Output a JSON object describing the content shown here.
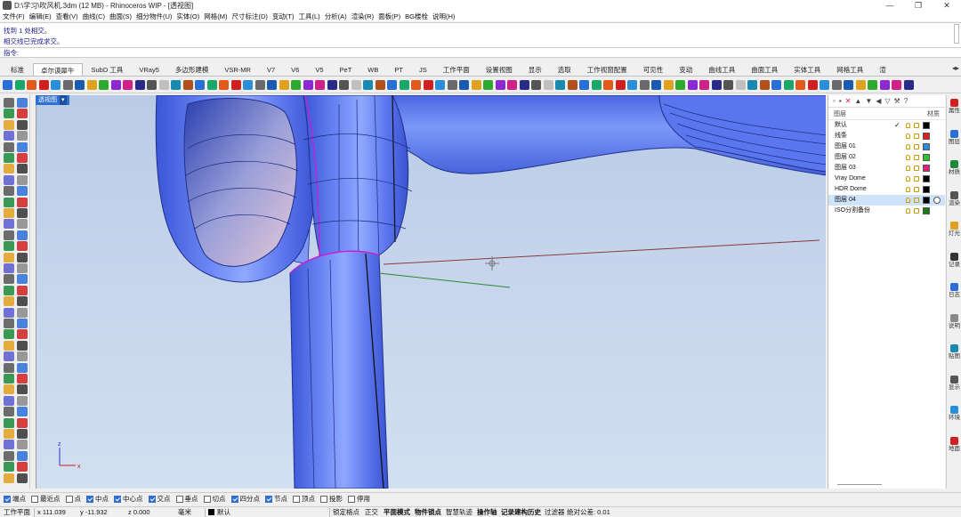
{
  "window": {
    "title": "D:\\学习\\吹风机.3dm (12 MB) - Rhinoceros WIP - [透视图]",
    "controls": [
      "—",
      "❐",
      "✕"
    ]
  },
  "menu": [
    "文件(F)",
    "编辑(E)",
    "查看(V)",
    "曲线(C)",
    "曲面(S)",
    "细分物件(U)",
    "实体(O)",
    "网格(M)",
    "尺寸标注(D)",
    "变动(T)",
    "工具(L)",
    "分析(A)",
    "渲染(R)",
    "面板(P)",
    "BG楼栓",
    "说明(H)"
  ],
  "command_history": [
    "找到 1 处相交。",
    "相交线已完成求交。"
  ],
  "command_prompt": "指令:",
  "toolbar_tabs": [
    "标准",
    "卓尔谟犀牛",
    "SubD 工具",
    "VRay5",
    "多边形建模",
    "VSR-MR",
    "V7",
    "V6",
    "V5",
    "PeT",
    "WB",
    "PT",
    "JS",
    "工作平面",
    "设置视图",
    "显示",
    "选取",
    "工作视窗配置",
    "可见性",
    "变动",
    "曲线工具",
    "曲面工具",
    "实体工具",
    "网格工具",
    "渲"
  ],
  "active_tab_index": 1,
  "viewport": {
    "label": "透视图",
    "axis": {
      "z": "z",
      "x": "x"
    }
  },
  "layers_panel": {
    "header_left": "图层",
    "header_right": "材质",
    "layers": [
      {
        "name": "默认",
        "current": "✓",
        "color": "#000000"
      },
      {
        "name": "线条",
        "current": "",
        "color": "#e02020"
      },
      {
        "name": "图层 01",
        "current": "",
        "color": "#2a8fd8"
      },
      {
        "name": "图层 02",
        "current": "",
        "color": "#2ec22e"
      },
      {
        "name": "图层 03",
        "current": "",
        "color": "#e0207a"
      },
      {
        "name": "Vray Dome",
        "current": "",
        "color": "#000000"
      },
      {
        "name": "HDR Dome",
        "current": "",
        "color": "#000000"
      },
      {
        "name": "图层 04",
        "current": "",
        "color": "#000000",
        "selected": true
      },
      {
        "name": "ISO分割备份",
        "current": "",
        "color": "#1a7a1a"
      }
    ]
  },
  "side_tabs": [
    "属性",
    "图层",
    "材质",
    "渲染",
    "灯光",
    "记录",
    "日志",
    "说明",
    "贴图",
    "显示",
    "环境",
    "地面"
  ],
  "osnap": [
    {
      "label": "端点",
      "on": true
    },
    {
      "label": "最近点",
      "on": false
    },
    {
      "label": "点",
      "on": false
    },
    {
      "label": "中点",
      "on": true
    },
    {
      "label": "中心点",
      "on": true
    },
    {
      "label": "交点",
      "on": true
    },
    {
      "label": "垂点",
      "on": false
    },
    {
      "label": "切点",
      "on": false
    },
    {
      "label": "四分点",
      "on": true
    },
    {
      "label": "节点",
      "on": true
    },
    {
      "label": "顶点",
      "on": false
    },
    {
      "label": "投影",
      "on": false
    },
    {
      "label": "停用",
      "on": false
    }
  ],
  "status": {
    "cplane": "工作平面",
    "x": "x 111.039",
    "y": "y -11.932",
    "z": "z 0.000",
    "units": "毫米",
    "layer": "默认",
    "lock_grid": "锁定格点",
    "ortho": "正交",
    "planar": "平面模式",
    "osnap": "物件锁点",
    "smarttrack": "智慧轨迹",
    "gumball": "操作轴",
    "history": "记录建构历史",
    "filter": "过滤器",
    "tolerance": "绝对公差: 0.01"
  }
}
